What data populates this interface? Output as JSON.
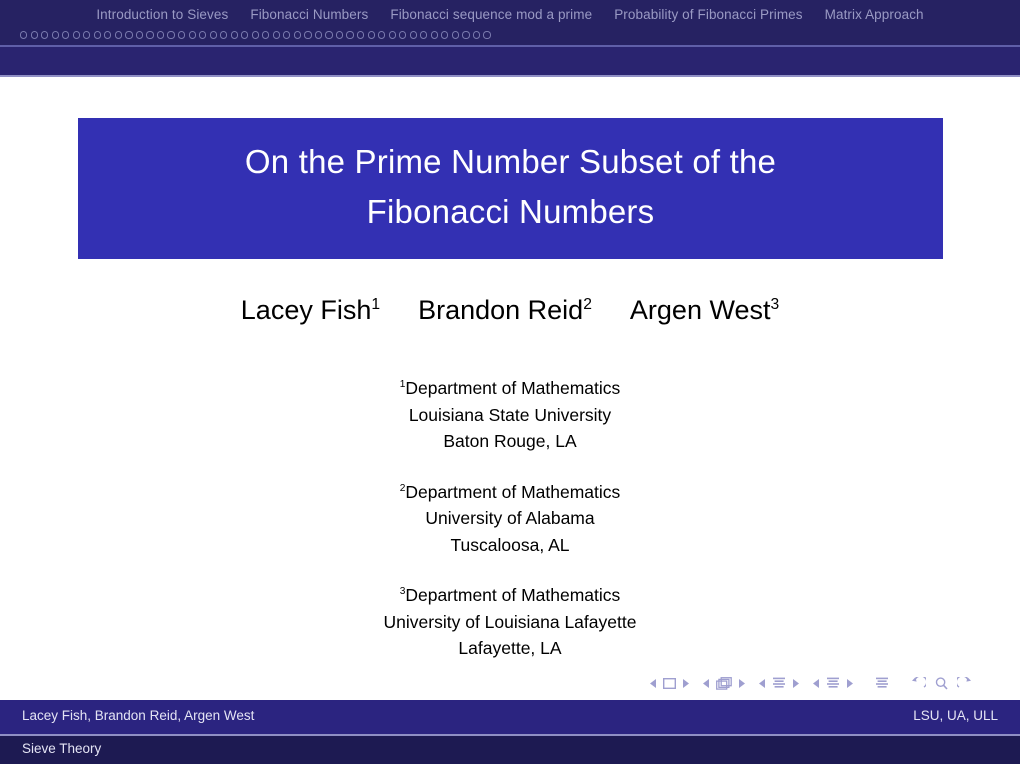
{
  "header": {
    "sections": [
      "Introduction to Sieves",
      "Fibonacci Numbers",
      "Fibonacci sequence mod a prime",
      "Probability of Fibonacci Primes",
      "Matrix Approach"
    ],
    "nav_dot_count": 45,
    "bar_color": "#262262",
    "text_color": "#9a9ac4"
  },
  "title": {
    "line1": "On the Prime Number Subset of the",
    "line2": "Fibonacci Numbers",
    "block_color": "#3330b3",
    "text_color": "#ffffff"
  },
  "authors": [
    {
      "name": "Lacey Fish",
      "mark": "1"
    },
    {
      "name": "Brandon Reid",
      "mark": "2"
    },
    {
      "name": "Argen West",
      "mark": "3"
    }
  ],
  "affiliations": [
    {
      "mark": "1",
      "department": "Department of Mathematics",
      "institution": "Louisiana State University",
      "location": "Baton Rouge, LA"
    },
    {
      "mark": "2",
      "department": "Department of Mathematics",
      "institution": "University of Alabama",
      "location": "Tuscaloosa, AL"
    },
    {
      "mark": "3",
      "department": "Department of Mathematics",
      "institution": "University of Louisiana Lafayette",
      "location": "Lafayette, LA"
    }
  ],
  "nav_symbols": [
    "prev-slide-icon",
    "slide-icon",
    "next-slide-icon",
    "prev-frame-icon",
    "frame-icon",
    "next-frame-icon",
    "prev-subsection-icon",
    "subsection-icon",
    "next-subsection-icon",
    "prev-section-icon",
    "section-icon",
    "next-section-icon",
    "presentation-icon",
    "back-icon",
    "find-icon",
    "forward-icon"
  ],
  "footer": {
    "authors_short": "Lacey Fish, Brandon Reid, Argen West",
    "institutions_short": "LSU, UA, ULL",
    "subtitle": "Sieve Theory",
    "bar_color": "#2b2480",
    "bar2_color": "#1d1a52"
  }
}
